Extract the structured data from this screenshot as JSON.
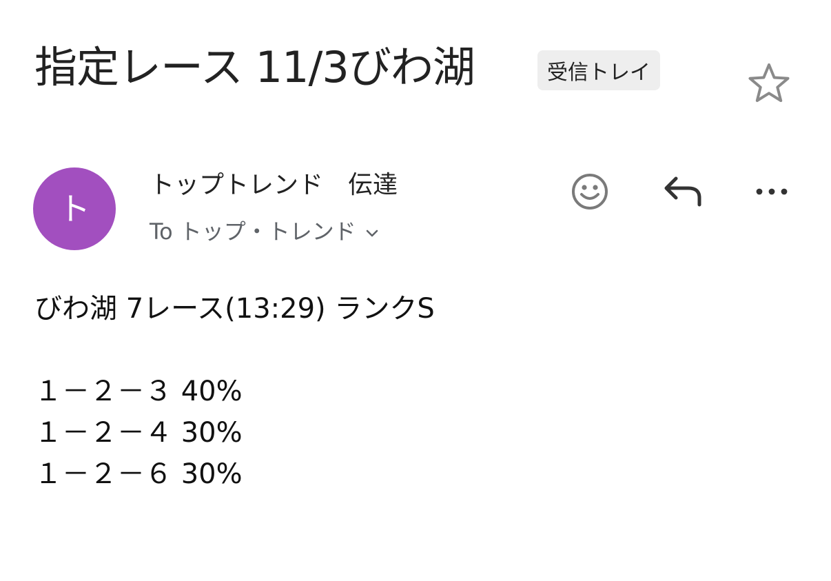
{
  "subject": "指定レース 11/3びわ湖",
  "label": "受信トレイ",
  "sender": {
    "avatar_letter": "ト",
    "avatar_color": "#a24fbf",
    "name": "トップトレンド　伝達",
    "to_prefix": "To",
    "recipient": "トップ・トレンド"
  },
  "icons": {
    "star": "star-outline-icon",
    "emoji": "smiley-icon",
    "reply": "reply-arrow-icon",
    "more": "more-horizontal-icon",
    "chevron": "chevron-down-icon"
  },
  "body": {
    "header_line": "びわ湖 7レース(13:29)  ランクS",
    "predictions": [
      "１－２－３  40%",
      "１－２－４  30%",
      "１－２－６  30%"
    ]
  }
}
